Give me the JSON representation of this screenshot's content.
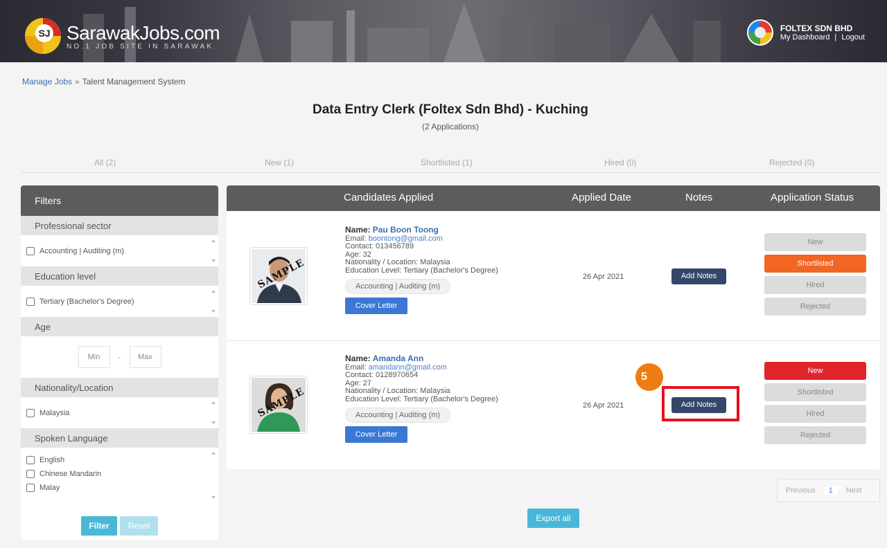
{
  "header": {
    "logo_title": "SarawakJobs.com",
    "logo_tagline": "NO.1 JOB SITE IN SARAWAK",
    "user_name": "FOLTEX SDN BHD",
    "dashboard_link": "My Dashboard",
    "link_separator": "|",
    "logout_link": "Logout"
  },
  "breadcrumb": {
    "parent": "Manage Jobs",
    "separator": "»",
    "current": "Talent Management System"
  },
  "job": {
    "title": "Data Entry Clerk (Foltex Sdn Bhd) - Kuching",
    "subtitle": "(2 Applications)"
  },
  "tabs": [
    {
      "label": "All (2)"
    },
    {
      "label": "New (1)"
    },
    {
      "label": "Shortlisted (1)"
    },
    {
      "label": "Hired (0)"
    },
    {
      "label": "Rejected (0)"
    }
  ],
  "filters": {
    "title": "Filters",
    "sections": {
      "professional_sector": {
        "title": "Professional sector",
        "options": [
          "Accounting | Auditing (m)"
        ]
      },
      "education_level": {
        "title": "Education level",
        "options": [
          "Tertiary (Bachelor's Degree)"
        ]
      },
      "age": {
        "title": "Age",
        "min_placeholder": "Min",
        "dash": "-",
        "max_placeholder": "Max"
      },
      "nationality": {
        "title": "Nationality/Location",
        "options": [
          "Malaysia"
        ]
      },
      "spoken_language": {
        "title": "Spoken Language",
        "options": [
          "English",
          "Chinese Mandarin",
          "Malay"
        ]
      }
    },
    "filter_button": "Filter",
    "reset_button": "Reset"
  },
  "table": {
    "headers": {
      "candidates": "Candidates Applied",
      "applied_date": "Applied Date",
      "notes": "Notes",
      "status": "Application Status"
    },
    "rows": [
      {
        "name_label": "Name:",
        "name": "Pau Boon Toong",
        "email_label": "Email:",
        "email": "boontong@gmail.com",
        "contact": "Contact: 013456789",
        "age": "Age: 32",
        "nationality": "Nationality / Location: Malaysia",
        "education": "Education Level: Tertiary (Bachelor's Degree)",
        "sector_tag": "Accounting | Auditing (m)",
        "cover_letter": "Cover Letter",
        "photo_watermark": "SAMPLE",
        "applied_date": "26 Apr 2021",
        "notes_button": "Add Notes",
        "status_options": [
          "New",
          "Shortlisted",
          "Hired",
          "Rejected"
        ],
        "selected_status": "Shortlisted"
      },
      {
        "name_label": "Name:",
        "name": "Amanda Ann",
        "email_label": "Email:",
        "email": "amandann@gmail.com",
        "contact": "Contact: 0128970654",
        "age": "Age: 27",
        "nationality": "Nationality / Location: Malaysia",
        "education": "Education Level: Tertiary (Bachelor's Degree)",
        "sector_tag": "Accounting | Auditing (m)",
        "cover_letter": "Cover Letter",
        "photo_watermark": "SAMPLE",
        "applied_date": "26 Apr 2021",
        "notes_button": "Add Notes",
        "status_options": [
          "New",
          "Shortlisted",
          "Hired",
          "Rejected"
        ],
        "selected_status": "New"
      }
    ]
  },
  "annotation": {
    "step_number": "5"
  },
  "pagination": {
    "previous": "Previous",
    "current_page": "1",
    "next": "Next"
  },
  "export_button": "Export all",
  "colors": {
    "header_dark": "#5c5c5c",
    "shortlisted": "#f26522",
    "new_selected": "#e0252b",
    "notes_button": "#34476a",
    "cover_letter": "#3a78d4",
    "filter_button": "#49b8d8",
    "highlight": "#e3121b",
    "step_badge": "#ee7d11"
  }
}
